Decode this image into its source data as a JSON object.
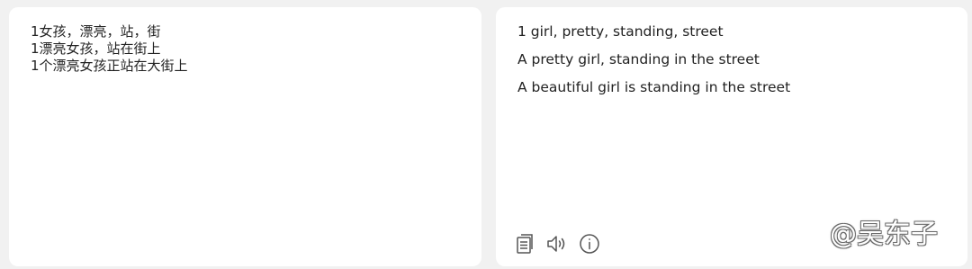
{
  "source_panel": {
    "lines": [
      "1女孩，漂亮，站，街",
      "1漂亮女孩，站在街上",
      "1个漂亮女孩正站在大街上"
    ]
  },
  "target_panel": {
    "lines": [
      "1 girl, pretty, standing, street",
      "A pretty girl, standing in the street",
      "A beautiful girl is standing in the street"
    ],
    "toolbar": {
      "icons": [
        "copy-icon",
        "speaker-icon",
        "info-icon"
      ]
    }
  },
  "watermark": "@吴东子",
  "colors": {
    "page_background": "#f1f1f1",
    "panel_background": "#ffffff",
    "text": "#222222",
    "icon": "#555555"
  }
}
